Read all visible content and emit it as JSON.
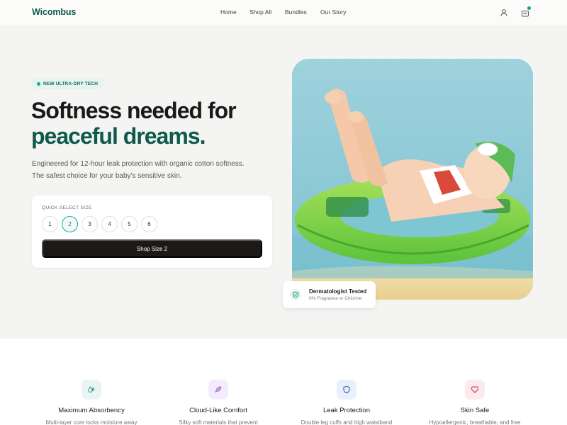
{
  "brand": {
    "name": "Wicombus"
  },
  "nav": {
    "links": [
      "Home",
      "Shop All",
      "Bundles",
      "Our Story"
    ],
    "icons": [
      "user-icon",
      "cart-icon"
    ]
  },
  "hero": {
    "badge": "NEW ULTRA-DRY TECH",
    "headline_line1": "Softness needed for",
    "headline_line2": "peaceful dreams.",
    "subtitle": "Engineered for 12-hour leak protection with organic cotton softness. The safest choice for your baby's sensitive skin.",
    "size_selector": {
      "label": "QUICK SELECT SIZE",
      "sizes": [
        "1",
        "2",
        "3",
        "4",
        "5",
        "6"
      ],
      "selected": "2",
      "button_label": "Shop Size 2"
    },
    "trust_badge": {
      "title": "Dermatologist Tested",
      "subtitle": "0% Fragrance or Chlorine"
    }
  },
  "features": [
    {
      "title": "Maximum Absorbency",
      "desc": "Multi-layer core locks moisture away",
      "icon": "droplet-icon",
      "color": "#1a8f7c",
      "bg": "#e9f5f2"
    },
    {
      "title": "Cloud-Like Comfort",
      "desc": "Silky soft materials that prevent",
      "icon": "feather-icon",
      "color": "#9a4bd1",
      "bg": "#f4ecfb"
    },
    {
      "title": "Leak Protection",
      "desc": "Double leg cuffs and high waistband",
      "icon": "shield-icon",
      "color": "#2f5fc4",
      "bg": "#e9effb"
    },
    {
      "title": "Skin Safe",
      "desc": "Hypoallergenic, breathable, and free",
      "icon": "heart-icon",
      "color": "#d6304f",
      "bg": "#fbeaee"
    }
  ],
  "colors": {
    "brand": "#0f5a4b",
    "accent": "#1aa78f",
    "button": "#1b1a18"
  }
}
